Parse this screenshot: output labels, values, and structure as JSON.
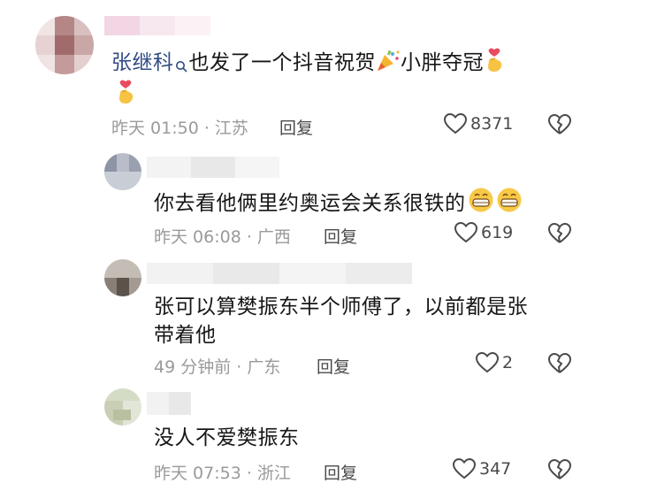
{
  "comments": [
    {
      "mention": "张继科",
      "text": "也发了一个抖音祝贺",
      "text_after_emoji": "小胖夺冠",
      "meta": "昨天 01:50 · 江苏",
      "reply": "回复",
      "likes": "8371"
    },
    {
      "text": "你去看他俩里约奥运会关系很铁的",
      "meta": "昨天 06:08 · 广西",
      "reply": "回复",
      "likes": "619"
    },
    {
      "text_line1": "张可以算樊振东半个师傅了，以前都是张",
      "text_line2": "带着他",
      "meta": "49 分钟前 · 广东",
      "reply": "回复",
      "likes": "2"
    },
    {
      "text": "没人不爱樊振东",
      "meta": "昨天 07:53 · 浙江",
      "reply": "回复",
      "likes": "347"
    }
  ],
  "icons": {
    "like": "heart-outline-icon",
    "dislike": "broken-heart-icon",
    "search": "search-icon",
    "party": "party-popper-icon",
    "finger_heart": "finger-heart-icon",
    "grin": "grinning-emoji-icon"
  },
  "colors": {
    "mention": "#2f4b84",
    "meta": "#9a9a9a"
  }
}
